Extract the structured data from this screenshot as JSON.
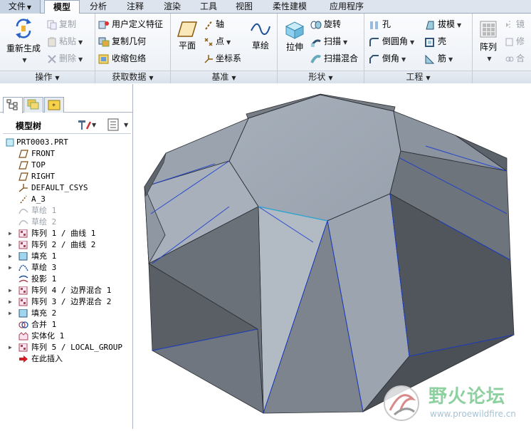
{
  "tabs": [
    {
      "label": "文件",
      "caret": "▼"
    },
    {
      "label": "模型"
    },
    {
      "label": "分析"
    },
    {
      "label": "注释"
    },
    {
      "label": "渲染"
    },
    {
      "label": "工具"
    },
    {
      "label": "视图"
    },
    {
      "label": "柔性建模"
    },
    {
      "label": "应用程序"
    }
  ],
  "ribbon": {
    "operations": {
      "label": "操作",
      "regenerate": "重新生成",
      "copy": "复制",
      "paste": "粘贴",
      "delete": "删除"
    },
    "get_data": {
      "label": "获取数据",
      "udf": "用户定义特征",
      "copy_geom": "复制几何",
      "shrinkwrap": "收缩包络"
    },
    "datum": {
      "label": "基准",
      "plane": "平面",
      "axis": "轴",
      "point": "点",
      "csys": "坐标系",
      "sketch": "草绘"
    },
    "shapes": {
      "label": "形状",
      "extrude": "拉伸",
      "revolve": "旋转",
      "sweep": "扫描",
      "swept_blend": "扫描混合"
    },
    "engineering": {
      "label": "工程",
      "hole": "孔",
      "round": "倒圆角",
      "chamfer": "倒角",
      "draft": "拔模",
      "shell": "壳",
      "rib": "筋"
    },
    "editing": {
      "pattern": "阵列",
      "mirror": "镜",
      "modify": "修",
      "merge": "合"
    }
  },
  "model_tree": {
    "title": "模型树",
    "items": [
      {
        "label": "PRT0003.PRT"
      },
      {
        "label": "FRONT"
      },
      {
        "label": "TOP"
      },
      {
        "label": "RIGHT"
      },
      {
        "label": "DEFAULT_CSYS"
      },
      {
        "label": "A_3"
      },
      {
        "label": "草绘 1"
      },
      {
        "label": "草绘 2"
      },
      {
        "label": "阵列 1 / 曲线 1"
      },
      {
        "label": "阵列 2 / 曲线 2"
      },
      {
        "label": "填充 1"
      },
      {
        "label": "草绘 3"
      },
      {
        "label": "投影 1"
      },
      {
        "label": "阵列 4 / 边界混合 1"
      },
      {
        "label": "阵列 3 / 边界混合 2"
      },
      {
        "label": "填充 2"
      },
      {
        "label": "合并 1"
      },
      {
        "label": "实体化 1"
      },
      {
        "label": "阵列 5 / LOCAL_GROUP"
      },
      {
        "label": "在此插入"
      }
    ]
  },
  "watermark": {
    "title": "野火论坛",
    "url": "www.proewildfire.cn"
  },
  "colors": {
    "accent": "#1f5fbf",
    "model_face_light": "#a7b0bb",
    "model_face_dark": "#4b5057",
    "edge": "#1a3fd0"
  }
}
